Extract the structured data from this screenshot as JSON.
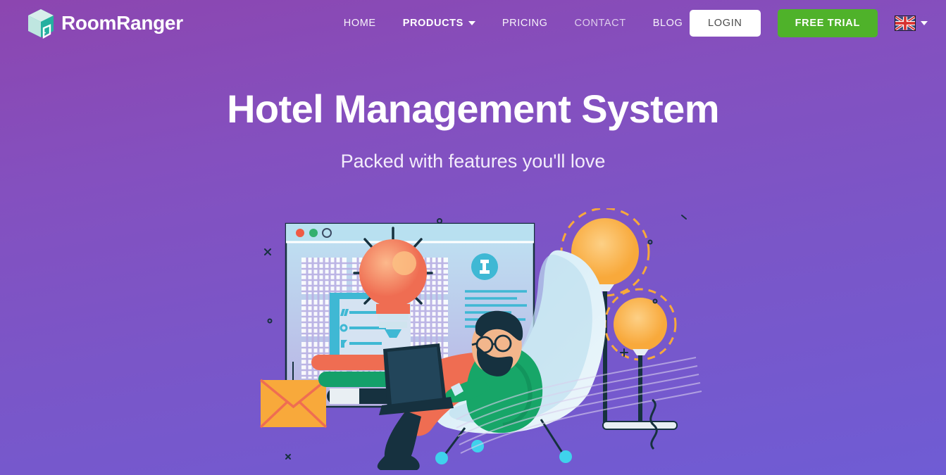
{
  "brand": {
    "name": "RoomRanger",
    "logo_icon": "cube-room-icon",
    "logo_colors": {
      "left_face": "#bfe6e0",
      "right_face": "#25b0a0",
      "top_face": "#d8eeeb"
    }
  },
  "nav": {
    "items": [
      {
        "label": "HOME",
        "state": "normal",
        "has_dropdown": false
      },
      {
        "label": "PRODUCTS",
        "state": "active",
        "has_dropdown": true
      },
      {
        "label": "PRICING",
        "state": "normal",
        "has_dropdown": false
      },
      {
        "label": "CONTACT",
        "state": "dim",
        "has_dropdown": false
      },
      {
        "label": "BLOG",
        "state": "normal",
        "has_dropdown": false
      }
    ]
  },
  "actions": {
    "login_label": "LOGIN",
    "trial_label": "FREE TRIAL",
    "login_bg": "#ffffff",
    "login_text_color": "#4a4a4a",
    "trial_bg": "#4fb22a",
    "language_icon": "uk-flag-icon",
    "language_caret_icon": "chevron-down-icon"
  },
  "hero": {
    "title": "Hotel Management System",
    "subtitle": "Packed with features you'll love"
  },
  "theme": {
    "gradient_top": "#8c46b0",
    "gradient_bottom": "#6f5cd4",
    "accent_green": "#4fb22a",
    "accent_teal": "#25b0a0",
    "accent_orange": "#f8a93b",
    "accent_coral": "#ef6d52",
    "accent_navy": "#16313f"
  },
  "illustration": {
    "name": "man-working-on-laptop-illustration",
    "elements": [
      "browser-window",
      "traffic-light-dots",
      "lightbulb",
      "checklist-card",
      "book-stack",
      "envelope",
      "seated-man-with-laptop",
      "lounge-chair",
      "floor-lamp-large",
      "floor-lamp-small"
    ],
    "dots": [
      {
        "name": "red-dot",
        "color": "#ef5b45"
      },
      {
        "name": "green-dot",
        "color": "#34b06f"
      },
      {
        "name": "outline-dot",
        "color": "#3b4a63"
      }
    ]
  }
}
